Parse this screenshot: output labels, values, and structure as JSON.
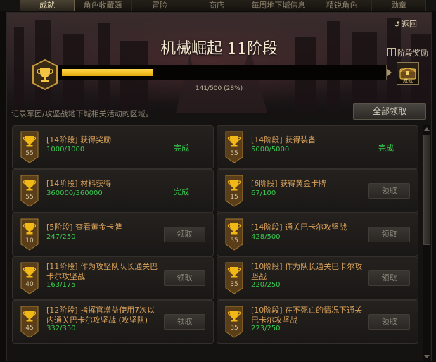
{
  "tabs": [
    {
      "label": "成就",
      "active": true
    },
    {
      "label": "角色收藏簿",
      "active": false
    },
    {
      "label": "冒险",
      "active": false
    },
    {
      "label": "商店",
      "active": false
    },
    {
      "label": "每周地下城信息",
      "active": false
    },
    {
      "label": "精锐角色",
      "active": false
    },
    {
      "label": "勋章",
      "active": false
    }
  ],
  "header": {
    "back_label": "返回",
    "title": "机械崛起 11阶段",
    "stage_reward_label": "阶段奖励",
    "chest_label": "成就",
    "progress_text": "141/500 (28%)",
    "progress_current": 141,
    "progress_total": 500,
    "description": "记录军团/攻坚战地下城相关活动的区域。",
    "claim_all_label": "全部领取"
  },
  "achievements": [
    {
      "level": "55",
      "title": "[14阶段] 获得奖励",
      "count": "1000/1000",
      "status": "完成",
      "done": true
    },
    {
      "level": "55",
      "title": "[14阶段] 获得装备",
      "count": "5000/5000",
      "status": "完成",
      "done": true
    },
    {
      "level": "55",
      "title": "[14阶段] 材料获得",
      "count": "360000/360000",
      "status": "完成",
      "done": true
    },
    {
      "level": "15",
      "title": "[6阶段] 获得黄金卡牌",
      "count": "67/100",
      "status": "领取",
      "done": false
    },
    {
      "level": "10",
      "title": "[5阶段] 查看黄金卡牌",
      "count": "247/250",
      "status": "领取",
      "done": false
    },
    {
      "level": "55",
      "title": "[14阶段] 通关巴卡尔攻坚战",
      "count": "428/500",
      "status": "领取",
      "done": false
    },
    {
      "level": "40",
      "title": "[11阶段] 作为攻坚队队长通关巴卡尔攻坚战",
      "count": "163/175",
      "status": "领取",
      "done": false
    },
    {
      "level": "35",
      "title": "[10阶段] 作为队长通关巴卡尔攻坚战",
      "count": "220/250",
      "status": "领取",
      "done": false
    },
    {
      "level": "45",
      "title": "[12阶段] 指挥官增益使用7次以内通关巴卡尔攻坚战 (攻坚队)",
      "count": "332/350",
      "status": "领取",
      "done": false
    },
    {
      "level": "35",
      "title": "[10阶段] 在不死亡的情况下通关巴卡尔攻坚战",
      "count": "223/250",
      "status": "领取",
      "done": false
    }
  ],
  "colors": {
    "accent_gold": "#f2b816",
    "complete_green": "#39c84f",
    "title_orange": "#d9a15a"
  }
}
